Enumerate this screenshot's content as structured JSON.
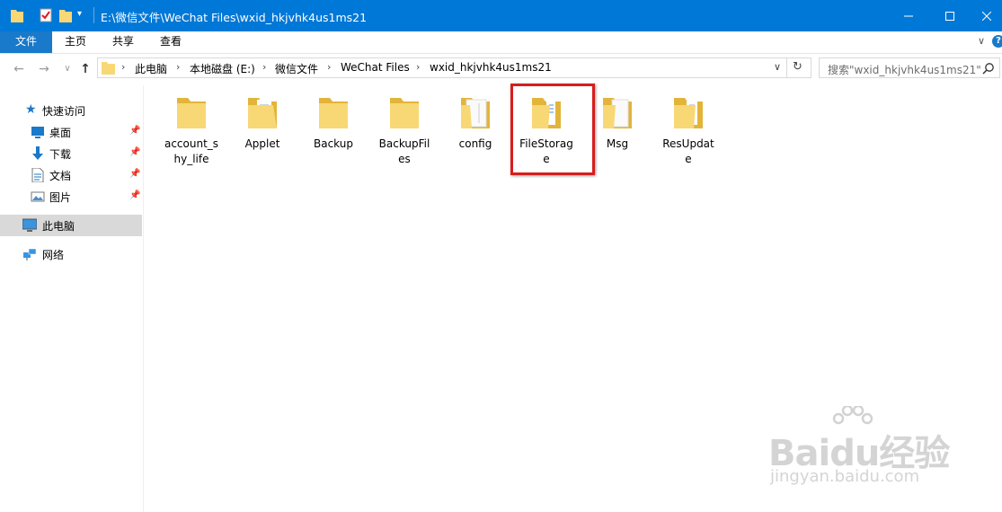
{
  "window": {
    "title": "E:\\微信文件\\WeChat Files\\wxid_hkjvhk4us1ms21"
  },
  "ribbon": {
    "tabs": [
      {
        "label": "文件"
      },
      {
        "label": "主页"
      },
      {
        "label": "共享"
      },
      {
        "label": "查看"
      }
    ]
  },
  "address": {
    "crumbs": [
      "此电脑",
      "本地磁盘 (E:)",
      "微信文件",
      "WeChat Files",
      "wxid_hkjvhk4us1ms21"
    ],
    "search_placeholder": "搜索\"wxid_hkjvhk4us1ms21\""
  },
  "sidebar": {
    "quick_access": "快速访问",
    "items": [
      {
        "label": "桌面",
        "icon": "desktop-icon"
      },
      {
        "label": "下载",
        "icon": "download-icon"
      },
      {
        "label": "文档",
        "icon": "document-icon"
      },
      {
        "label": "图片",
        "icon": "picture-icon"
      }
    ],
    "this_pc": "此电脑",
    "network": "网络"
  },
  "folders": [
    {
      "line1": "account_s",
      "line2": "hy_life"
    },
    {
      "line1": "Applet",
      "line2": ""
    },
    {
      "line1": "Backup",
      "line2": ""
    },
    {
      "line1": "BackupFil",
      "line2": "es"
    },
    {
      "line1": "config",
      "line2": ""
    },
    {
      "line1": "FileStorag",
      "line2": "e"
    },
    {
      "line1": "Msg",
      "line2": ""
    },
    {
      "line1": "ResUpdat",
      "line2": "e"
    }
  ],
  "watermark": {
    "logo": "Baidu经验",
    "url": "jingyan.baidu.com"
  },
  "colors": {
    "titlebar": "#0078d7",
    "active_tab": "#1979ca",
    "folder": "#f8d775",
    "highlight": "#d71d1d"
  }
}
